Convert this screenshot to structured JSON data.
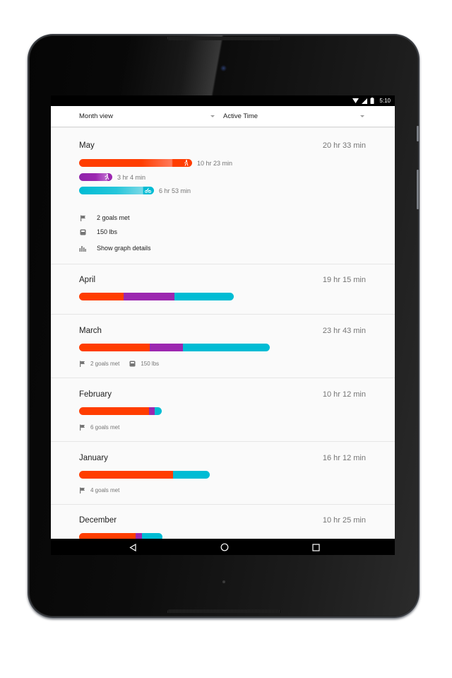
{
  "status_bar": {
    "icons": [
      "wifi-icon",
      "signal-icon",
      "battery-icon"
    ],
    "time": "5:10"
  },
  "header": {
    "view_dropdown": {
      "selected": "Month view"
    },
    "metric_dropdown": {
      "selected": "Active Time"
    }
  },
  "colors": {
    "walk": "#ff3d00",
    "run": "#9c27b0",
    "bike": "#00bcd4",
    "text_primary": "#212121",
    "text_secondary": "#757575"
  },
  "months": [
    {
      "name": "May",
      "total": "20 hr 33 min",
      "expanded": true,
      "activities": [
        {
          "type": "walk",
          "icon": "walking-icon",
          "duration": "10 hr 23 min",
          "minutes": 623
        },
        {
          "type": "run",
          "icon": "running-icon",
          "duration": "3 hr 4 min",
          "minutes": 184
        },
        {
          "type": "bike",
          "icon": "biking-icon",
          "duration": "6 hr 53 min",
          "minutes": 413
        }
      ],
      "goals": "2 goals met",
      "weight": "150 lbs",
      "graph_link": "Show graph details"
    },
    {
      "name": "April",
      "total": "19 hr 15 min",
      "segments": [
        {
          "type": "walk",
          "minutes": 331
        },
        {
          "type": "run",
          "minutes": 380
        },
        {
          "type": "bike",
          "minutes": 444
        }
      ]
    },
    {
      "name": "March",
      "total": "23 hr 43 min",
      "segments": [
        {
          "type": "walk",
          "minutes": 529
        },
        {
          "type": "run",
          "minutes": 246
        },
        {
          "type": "bike",
          "minutes": 648
        }
      ],
      "goals": "2 goals met",
      "weight": "150 lbs"
    },
    {
      "name": "February",
      "total": "10 hr 12 min",
      "segments": [
        {
          "type": "walk",
          "minutes": 520
        },
        {
          "type": "run",
          "minutes": 40
        },
        {
          "type": "bike",
          "minutes": 52
        }
      ],
      "goals": "6 goals met"
    },
    {
      "name": "January",
      "total": "16 hr 12 min",
      "segments": [
        {
          "type": "walk",
          "minutes": 700
        },
        {
          "type": "bike",
          "minutes": 272
        }
      ],
      "goals": "4 goals met"
    },
    {
      "name": "December",
      "total": "10 hr 25 min",
      "segments": [
        {
          "type": "walk",
          "minutes": 420
        },
        {
          "type": "run",
          "minutes": 50
        },
        {
          "type": "bike",
          "minutes": 155
        }
      ]
    }
  ],
  "nav_bar": {
    "buttons": [
      "back-icon",
      "home-icon",
      "recents-icon"
    ]
  }
}
